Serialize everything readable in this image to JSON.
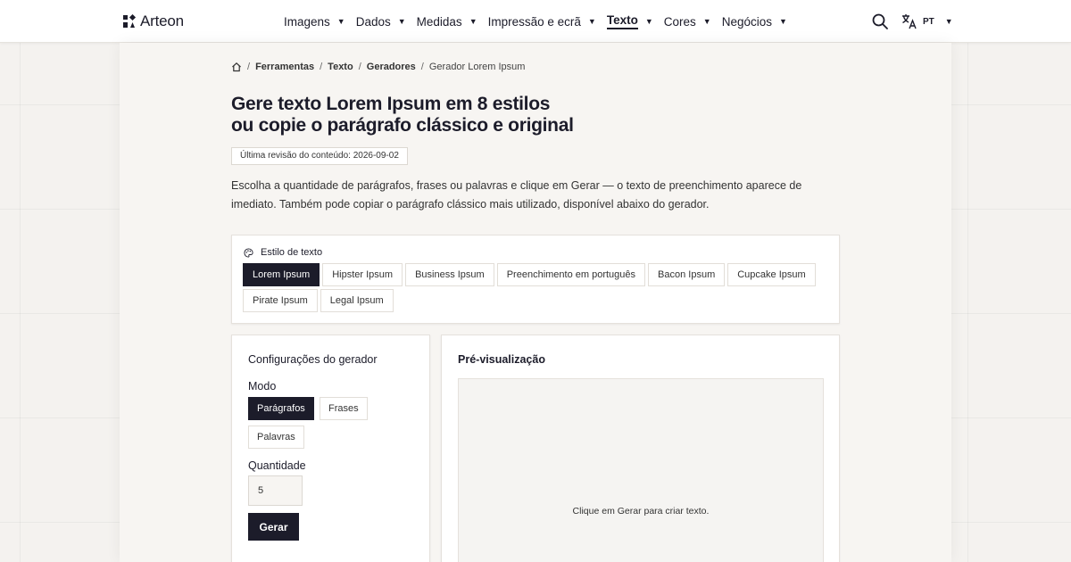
{
  "brand": {
    "name": "Arteon"
  },
  "nav": {
    "items": [
      {
        "label": "Imagens",
        "caret": "▼",
        "active": false
      },
      {
        "label": "Dados",
        "caret": "▼",
        "active": false
      },
      {
        "label": "Medidas",
        "caret": "▼",
        "active": false
      },
      {
        "label": "Impressão e ecrã",
        "caret": "▼",
        "active": false
      },
      {
        "label": "Texto",
        "caret": "▼",
        "active": true
      },
      {
        "label": "Cores",
        "caret": "▼",
        "active": false
      },
      {
        "label": "Negócios",
        "caret": "▼",
        "active": false
      }
    ],
    "search_icon": "search-icon",
    "language": {
      "code": "PT",
      "caret": "▼",
      "icon": "translate-icon"
    }
  },
  "breadcrumb": {
    "home_icon": "home-icon",
    "separator": "/",
    "items": [
      "Ferramentas",
      "Texto",
      "Geradores"
    ],
    "current": "Gerador Lorem Ipsum"
  },
  "page": {
    "title_line1": "Gere texto Lorem Ipsum em 8 estilos",
    "title_line2": "ou copie o parágrafo clássico e original",
    "revision": "Última revisão do conteúdo: 2026-09-02",
    "intro": "Escolha a quantidade de parágrafos, frases ou palavras e clique em Gerar — o texto de preenchimento aparece de imediato. Também pode copiar o parágrafo clássico mais utilizado, disponível abaixo do gerador."
  },
  "style_picker": {
    "label": "Estilo de texto",
    "icon": "palette-icon",
    "options": [
      "Lorem Ipsum",
      "Hipster Ipsum",
      "Business Ipsum",
      "Preenchimento em português",
      "Bacon Ipsum",
      "Cupcake Ipsum",
      "Pirate Ipsum",
      "Legal Ipsum"
    ],
    "selected": "Lorem Ipsum"
  },
  "settings": {
    "title": "Configurações do gerador",
    "mode_label": "Modo",
    "modes": [
      "Parágrafos",
      "Frases",
      "Palavras"
    ],
    "selected_mode": "Parágrafos",
    "quantity_label": "Quantidade",
    "quantity_value": "5",
    "generate_label": "Gerar"
  },
  "preview": {
    "title": "Pré-visualização",
    "empty_text": "Clique em Gerar para criar texto."
  },
  "colors": {
    "accent": "#1c1c2a",
    "page_background": "#f4f2ef",
    "card_background": "#ffffff"
  }
}
